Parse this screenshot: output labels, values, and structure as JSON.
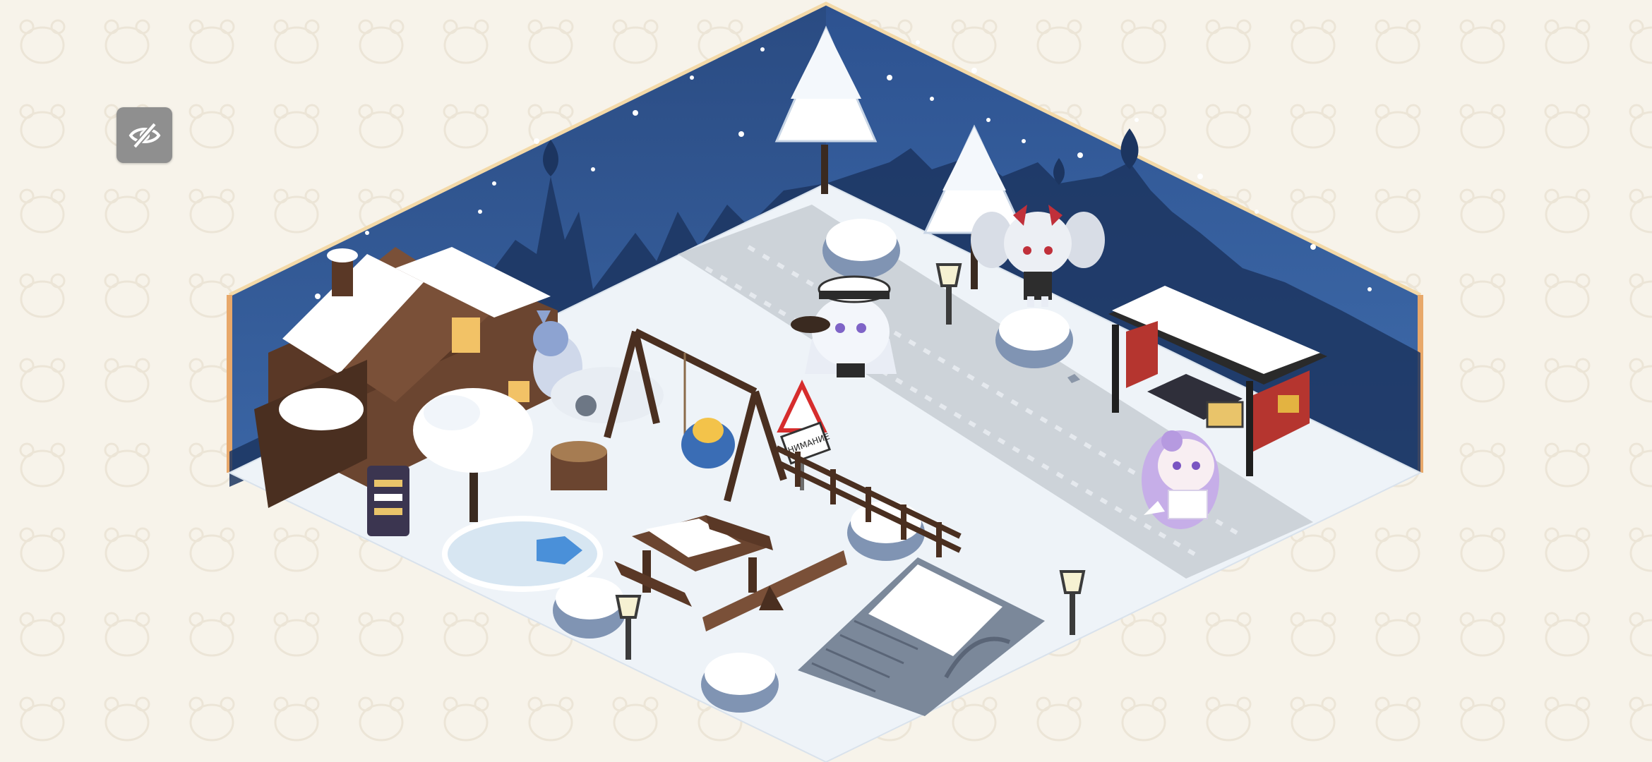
{
  "screen": "dorm-room",
  "theme": "winter",
  "colors": {
    "page_background": "#f7f3ea",
    "wall_night_sky": "#2c4f86",
    "floor_snow": "#eef3f8",
    "road_gray": "#bfc5cc",
    "hide_ui_button": "#8f8f8f",
    "wood_dark": "#5a3b2a"
  },
  "toolbar": {
    "hide_ui_icon": "eye-slash-icon"
  },
  "signs": {
    "warning_sign_text": "ВНИМАНИЕ"
  },
  "characters": [
    {
      "name": "white-captain-girl",
      "icon": "chibi-character"
    },
    {
      "name": "silver-twintail-girl",
      "icon": "chibi-character"
    },
    {
      "name": "purple-hair-girl",
      "icon": "chibi-character"
    },
    {
      "name": "blue-hair-girl",
      "icon": "chibi-character"
    }
  ],
  "furniture": [
    "snowy-wooden-house",
    "snowy-tree",
    "hiking-signboard",
    "frozen-pond",
    "wooden-swing",
    "tree-stump",
    "picnic-table",
    "seesaw",
    "warning-sign",
    "wooden-fence",
    "stone-bridge",
    "bus-stop-shelter",
    "street-lamp",
    "snow-pine-tree",
    "snow-bush",
    "onion-dome-silhouette"
  ]
}
